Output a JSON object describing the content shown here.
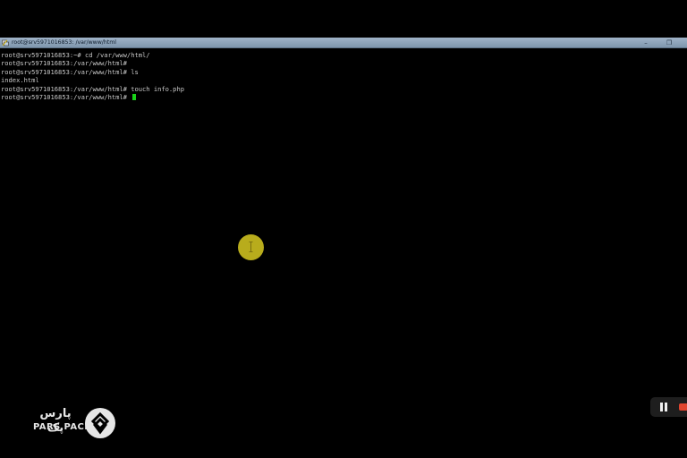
{
  "window": {
    "title": "root@srv5971016853: /var/www/html",
    "minimize_glyph": "–",
    "maximize_glyph": "❐"
  },
  "terminal": {
    "lines": [
      "root@srv5971016853:~# cd /var/www/html/",
      "root@srv5971016853:/var/www/html# ",
      "root@srv5971016853:/var/www/html# ls",
      "index.html",
      "root@srv5971016853:/var/www/html# touch info.php",
      "root@srv5971016853:/var/www/html# "
    ],
    "cursor_color": "#19d219"
  },
  "brand": {
    "name_fa": "پارس پک",
    "name_en": "PARS PACK"
  },
  "player": {
    "state": "playing",
    "icons": [
      "pause-icon",
      "record-indicator"
    ]
  },
  "colors": {
    "terminal_bg": "#000000",
    "terminal_fg": "#c8c8c8",
    "titlebar": "#9fb3c8",
    "click_marker": "#c8bb1e",
    "record": "#e0452f"
  }
}
